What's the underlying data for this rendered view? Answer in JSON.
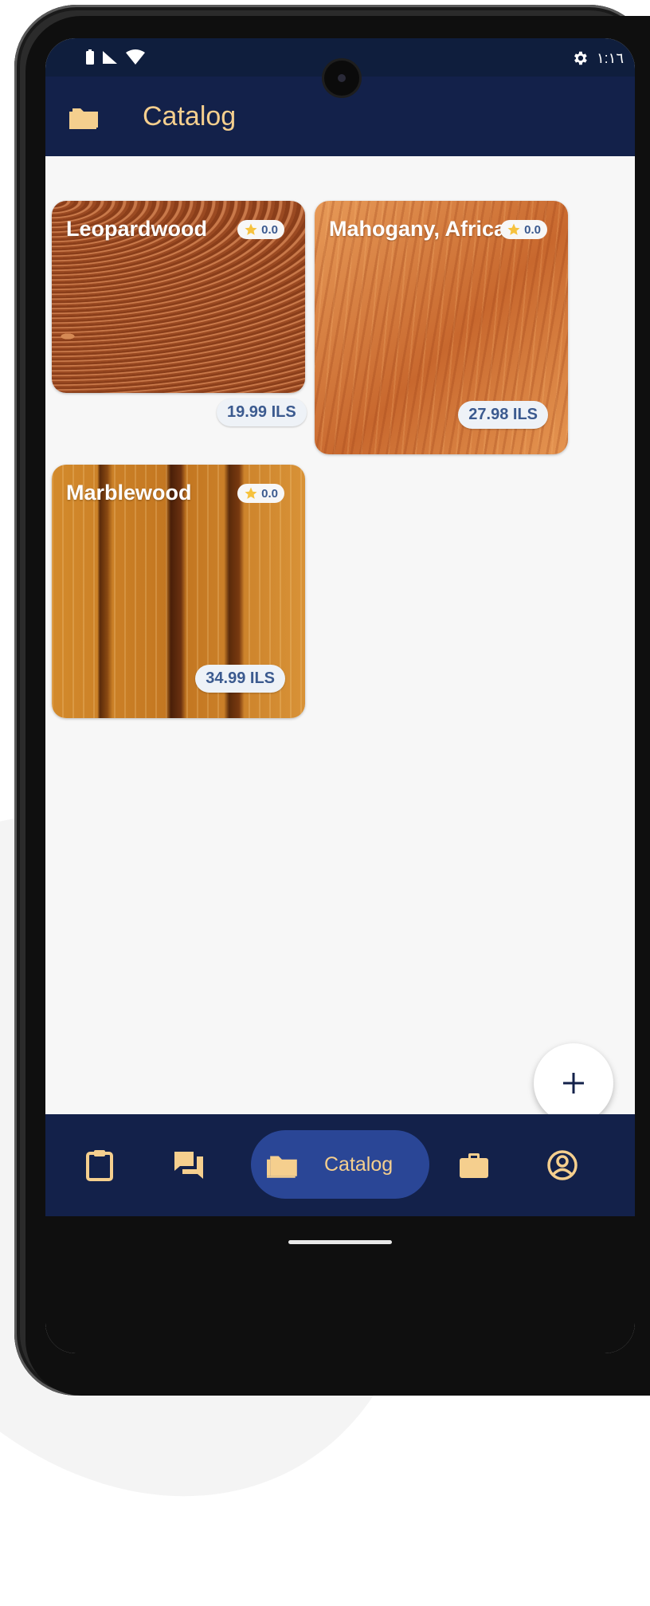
{
  "status_bar": {
    "time": "١:١٦"
  },
  "app_bar": {
    "title": "Catalog"
  },
  "cards": [
    {
      "title": "Leopardwood",
      "rating": "0.0",
      "price": "19.99 ILS"
    },
    {
      "title": "Mahogany, African",
      "rating": "0.0",
      "price": "27.98 ILS"
    },
    {
      "title": "Marblewood",
      "rating": "0.0",
      "price": "34.99 ILS"
    }
  ],
  "bottom_nav": {
    "items": [
      {
        "icon": "clipboard-icon"
      },
      {
        "icon": "chat-icon"
      },
      {
        "icon": "folder-icon",
        "label": "Catalog",
        "active": true
      },
      {
        "icon": "briefcase-icon"
      },
      {
        "icon": "account-circle-icon"
      }
    ]
  },
  "colors": {
    "app_bar": "#13214a",
    "accent": "#f5cf8e",
    "active_pill": "#2a4696",
    "chip_text": "#3b5a8f"
  }
}
